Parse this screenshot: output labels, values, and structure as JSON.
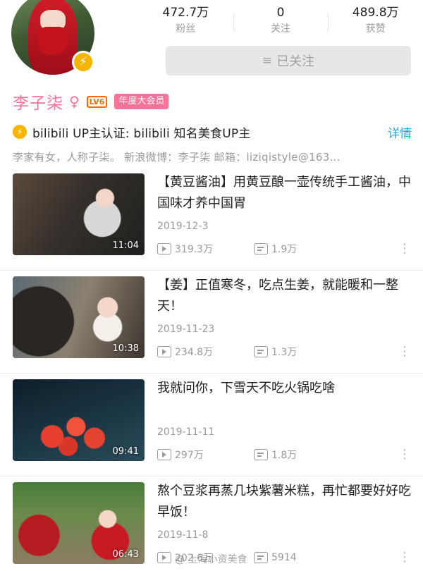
{
  "profile": {
    "name": "李子柒",
    "level": "LV6",
    "vip_badge": "年度大会员",
    "stats": [
      {
        "value": "472.7万",
        "label": "粉丝"
      },
      {
        "value": "0",
        "label": "关注"
      },
      {
        "value": "489.8万",
        "label": "获赞"
      }
    ],
    "follow_button": "已关注",
    "certification": "bilibili  UP主认证:  bilibili  知名美食UP主",
    "detail_link": "详情",
    "bio": "李家有女，人称子柒。  新浪微博：李子柒  邮箱：liziqistyle@163..."
  },
  "videos": [
    {
      "title": "【黄豆酱油】用黄豆酿一壶传统手工酱油，中国味才养中国胃",
      "date": "2019-12-3",
      "duration": "11:04",
      "plays": "319.3万",
      "danmaku": "1.9万"
    },
    {
      "title": "【姜】正值寒冬，吃点生姜，就能暖和一整天！",
      "date": "2019-11-23",
      "duration": "10:38",
      "plays": "234.8万",
      "danmaku": "1.3万"
    },
    {
      "title": "我就问你，下雪天不吃火锅吃啥",
      "date": "2019-11-11",
      "duration": "09:41",
      "plays": "297万",
      "danmaku": "1.8万"
    },
    {
      "title": "熬个豆浆再蒸几块紫薯米糕，再忙都要好好吃早饭！",
      "date": "2019-11-8",
      "duration": "06:43",
      "plays": "202.6万",
      "danmaku": "5914"
    }
  ],
  "watermark": "@ 上海小资美食",
  "colors": {
    "brand_pink": "#fb7299",
    "link_blue": "#23a6d8",
    "gold": "#f7b500"
  }
}
